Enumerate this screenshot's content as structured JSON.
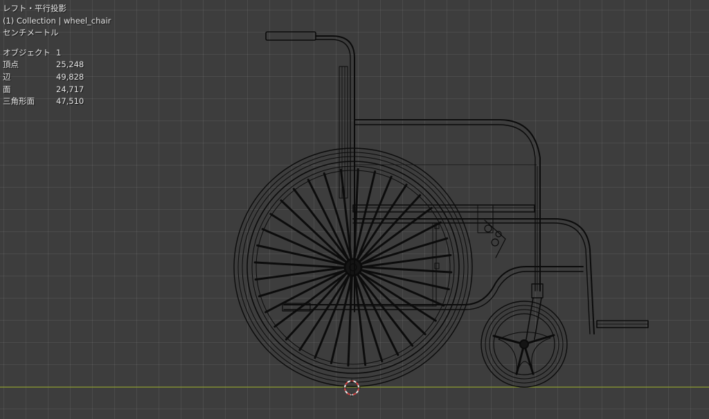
{
  "viewport": {
    "view_name": "レフト・平行投影",
    "collection_text": "(1) Collection | wheel_chair",
    "units": "センチメートル",
    "stats": [
      {
        "label": "オブジェクト",
        "value": "1"
      },
      {
        "label": "頂点",
        "value": "25,248"
      },
      {
        "label": "辺",
        "value": "49,828"
      },
      {
        "label": "面",
        "value": "24,717"
      },
      {
        "label": "三角形面",
        "value": "47,510"
      }
    ],
    "colors": {
      "background": "#3d3d3d",
      "grid": "#474747",
      "wire": "#0b0b0b",
      "floor_axis": "#8a9a2e",
      "cursor_red": "#d84040"
    },
    "icons": [
      "3d-cursor-icon"
    ]
  }
}
